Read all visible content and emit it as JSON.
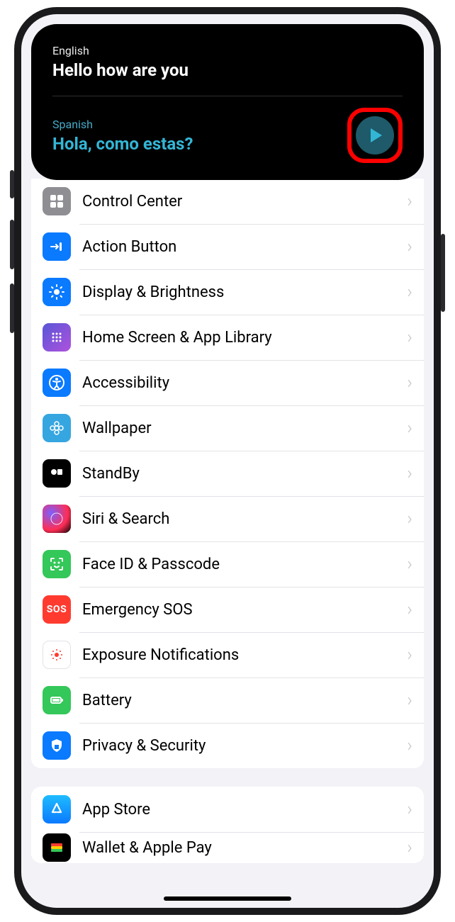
{
  "siri": {
    "source_lang": "English",
    "source_text": "Hello how are you",
    "target_lang": "Spanish",
    "target_text": "Hola, como estas?"
  },
  "groups": [
    {
      "rows": [
        {
          "id": "control-center",
          "label": "Control Center"
        },
        {
          "id": "action-button",
          "label": "Action Button"
        },
        {
          "id": "display-brightness",
          "label": "Display & Brightness"
        },
        {
          "id": "home-screen",
          "label": "Home Screen & App Library"
        },
        {
          "id": "accessibility",
          "label": "Accessibility"
        },
        {
          "id": "wallpaper",
          "label": "Wallpaper"
        },
        {
          "id": "standby",
          "label": "StandBy"
        },
        {
          "id": "siri-search",
          "label": "Siri & Search"
        },
        {
          "id": "face-id",
          "label": "Face ID & Passcode"
        },
        {
          "id": "emergency-sos",
          "label": "Emergency SOS"
        },
        {
          "id": "exposure",
          "label": "Exposure Notifications"
        },
        {
          "id": "battery",
          "label": "Battery"
        },
        {
          "id": "privacy",
          "label": "Privacy & Security"
        }
      ]
    },
    {
      "rows": [
        {
          "id": "app-store",
          "label": "App Store"
        },
        {
          "id": "wallet",
          "label": "Wallet & Apple Pay"
        }
      ]
    }
  ]
}
